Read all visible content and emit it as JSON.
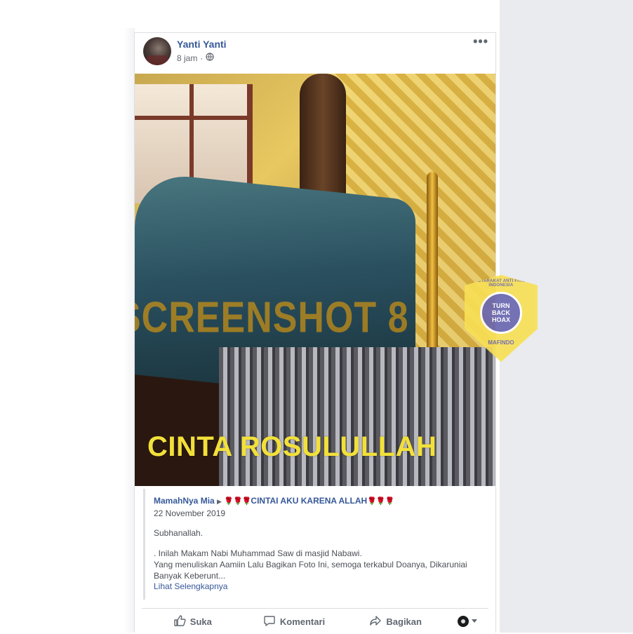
{
  "post": {
    "author": "Yanti Yanti",
    "time": "8 jam",
    "visibility_icon": "globe-icon",
    "more_label": "•••"
  },
  "photo": {
    "watermark": "SCREENSHOT 8",
    "caption_overlay": "CINTA ROSULULLAH",
    "badge": {
      "top_text": "MASYARAKAT ANTI FITNAH INDONESIA",
      "center_lines": [
        "TURN",
        "BACK",
        "HOAX"
      ],
      "bottom_text": "MAFINDO",
      "colors": {
        "shield": "#f7df55",
        "circle": "#6a66b0"
      }
    }
  },
  "shared": {
    "author": "MamahNya Mia",
    "arrow": "▶",
    "group_prefix_emoji": "🌹🌹🌹",
    "group": "CINTAI AKU KARENA ALLAH",
    "group_suffix_emoji": "🌹🌹🌹",
    "date": "22 November 2019",
    "paragraph1": "Subhanallah.",
    "paragraph2": ". Inilah Makam Nabi Muhammad Saw di masjid Nabawi.",
    "paragraph3": "Yang menuliskan Aamiin Lalu Bagikan Foto Ini, semoga terkabul Doanya, Dikaruniai Banyak Keberunt...",
    "see_more": "Lihat Selengkapnya"
  },
  "actions": {
    "like": "Suka",
    "comment": "Komentari",
    "share": "Bagikan"
  },
  "colors": {
    "link": "#365899",
    "text": "#1d2129",
    "muted": "#616770",
    "page_bg": "#e9ebee"
  }
}
